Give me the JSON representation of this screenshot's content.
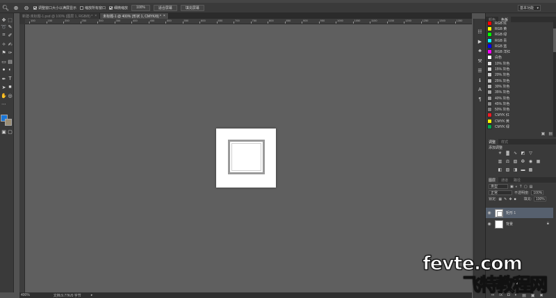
{
  "options_bar": {
    "check1_label": "调整窗口大小以满屏显示",
    "check2_label": "缩放所有窗口",
    "check3_label": "细微缩放",
    "btn_100": "100%",
    "btn_fit": "适合屏幕",
    "btn_fill": "填充屏幕",
    "workspace": "基本功能"
  },
  "tabs": [
    {
      "label": "新建-未标题-1.psd @ 100% (图层 1, RGB/8) *",
      "active": false
    },
    {
      "label": "未标题-1 @ 400% (形状 1, CMYK/8) *",
      "active": true
    }
  ],
  "ruler": {
    "ticks": [
      "100",
      "150",
      "200",
      "250",
      "300",
      "350",
      "400",
      "450",
      "500",
      "550",
      "600",
      "650",
      "700",
      "750",
      "800",
      "850",
      "900",
      "950",
      "1000",
      "1050",
      "1100",
      "1150",
      "1200",
      "1250",
      "1300",
      "1350"
    ]
  },
  "status": {
    "zoom": "400%",
    "doc": "文档:9.77K/0 字节"
  },
  "swatches_panel": {
    "tab1": "颜色",
    "tab2": "色板",
    "items": [
      {
        "name": "RGB 红",
        "color": "#ff0000"
      },
      {
        "name": "RGB 黄",
        "color": "#ffff00"
      },
      {
        "name": "RGB 绿",
        "color": "#00ff00"
      },
      {
        "name": "RGB 青",
        "color": "#00ffff"
      },
      {
        "name": "RGB 蓝",
        "color": "#0000ff"
      },
      {
        "name": "RGB 洋红",
        "color": "#ff00ff"
      },
      {
        "name": "白色",
        "color": "#ffffff"
      },
      {
        "name": "10% 灰色",
        "color": "#e6e6e6"
      },
      {
        "name": "15% 灰色",
        "color": "#d9d9d9"
      },
      {
        "name": "20% 灰色",
        "color": "#cccccc"
      },
      {
        "name": "25% 灰色",
        "color": "#bfbfbf"
      },
      {
        "name": "30% 灰色",
        "color": "#b3b3b3"
      },
      {
        "name": "35% 灰色",
        "color": "#a6a6a6"
      },
      {
        "name": "40% 灰色",
        "color": "#999999"
      },
      {
        "name": "45% 灰色",
        "color": "#8c8c8c"
      },
      {
        "name": "50% 灰色",
        "color": "#808080"
      },
      {
        "name": "CMYK 红",
        "color": "#ed1c24"
      },
      {
        "name": "CMYK 黄",
        "color": "#fff200"
      },
      {
        "name": "CMYK 绿",
        "color": "#00a651"
      }
    ]
  },
  "adjustments_panel": {
    "tab1": "调整",
    "tab2": "样式",
    "header": "添加调整"
  },
  "layers_panel": {
    "tab1": "图层",
    "tab2": "通道",
    "tab3": "路径",
    "kind_filter": "类型",
    "blend_mode": "正常",
    "opacity_label": "不透明度:",
    "opacity": "100%",
    "lock_label": "锁定:",
    "fill_label": "填充:",
    "fill": "100%",
    "layers": [
      {
        "name": "矩形 1",
        "selected": true
      },
      {
        "name": "背景",
        "selected": false
      }
    ]
  },
  "watermark": {
    "line1": "fevte.com",
    "line2": "飞特教程网"
  },
  "colors": {
    "foreground": "#1a76d8",
    "background": "#9b8e76",
    "canvas_bg": "#5f5f5f",
    "selected_layer": "#56606e"
  }
}
